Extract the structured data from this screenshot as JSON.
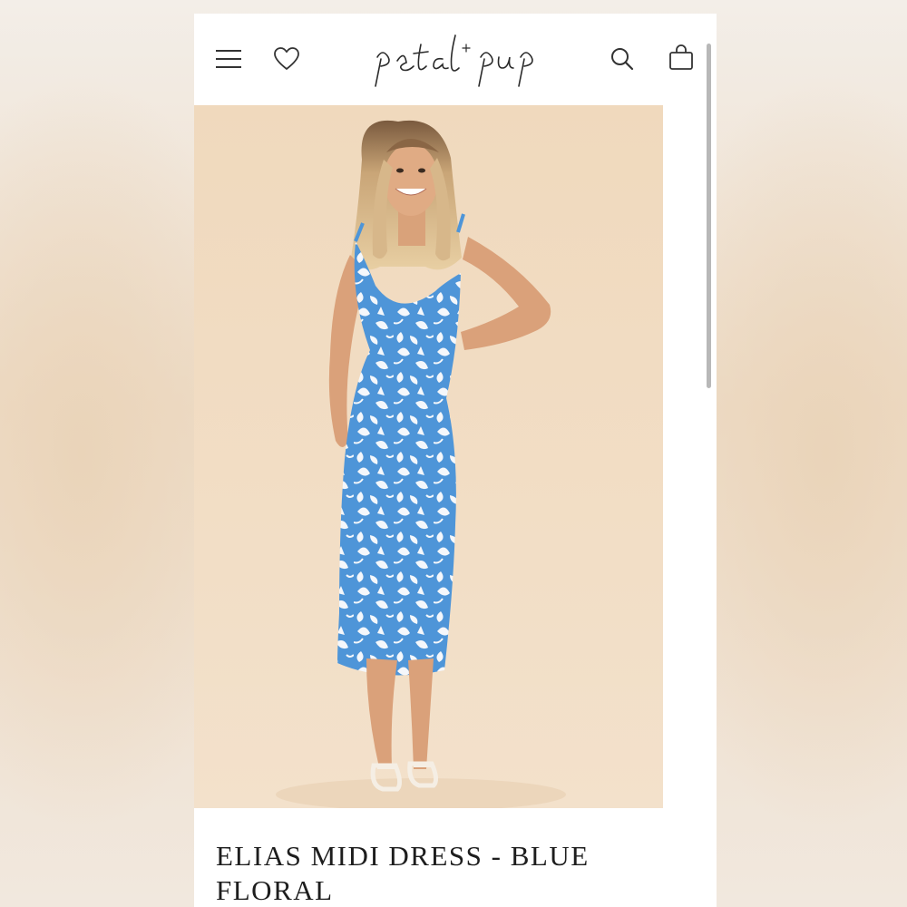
{
  "header": {
    "brand": "petal + pup",
    "icons": {
      "menu": "hamburger-menu-icon",
      "wishlist": "heart-icon",
      "search": "search-icon",
      "bag": "shopping-bag-icon"
    }
  },
  "product": {
    "title": "ELIAS MIDI DRESS - BLUE FLORAL",
    "image_description": "model-wearing-blue-floral-midi-dress"
  },
  "colors": {
    "background": "#efe4d6",
    "image_backdrop": "#f1dcc2",
    "dress_blue": "#4e95d8",
    "print_white": "#f4f7fb",
    "text": "#1d1d1d"
  }
}
